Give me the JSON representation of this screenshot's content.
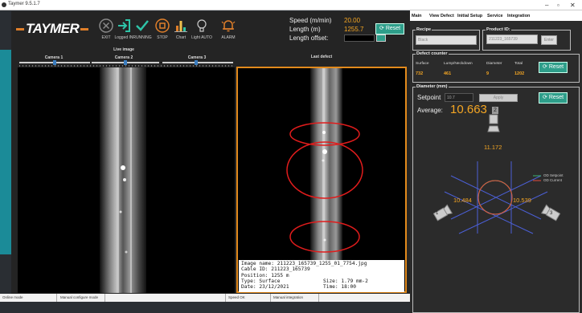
{
  "window": {
    "title": "Taymer 9.5.1.7"
  },
  "brand": {
    "logo_text": "TAYMER"
  },
  "toolbar": {
    "exit": "EXIT",
    "login": "Logged IN",
    "running": "RUNNING",
    "stop": "STOP",
    "chart": "Chart",
    "light": "Light AUTO",
    "alarm": "ALARM"
  },
  "readouts": {
    "speed_label": "Speed (m/min)",
    "speed_value": "20.00",
    "length_label": "Length (m)",
    "length_value": "1255.7",
    "offset_label": "Length offset:",
    "reset": "Reset"
  },
  "live": {
    "title": "Live image",
    "cam1": "Camera 1",
    "cam2": "Camera 2",
    "cam3": "Camera 3"
  },
  "last_defect": {
    "title": "Last defect",
    "image_name": "Image name: 211223_165739_1255_01_7754.jpg",
    "cable_id": "Cable ID: 211223_165739",
    "position": "Position: 1255 m",
    "type": "Type: Surface",
    "size": "Size: 1.79 mm-2",
    "date": "Date: 23/12/2021",
    "time": "Time: 18:00"
  },
  "status": {
    "online": "Online mode",
    "manual_config": "Manual configure mode",
    "speed": "Speed OK",
    "integration": "Manual integration"
  },
  "panel": {
    "tabs": [
      "Main",
      "View Defect",
      "Initial Setup",
      "Service",
      "Integration"
    ],
    "recipe": {
      "title": "Recipe",
      "value": "Black"
    },
    "product": {
      "title": "Product ID:",
      "value": "211223_165739",
      "button": "Enter"
    },
    "defects": {
      "title": "Defect counter",
      "headers": [
        "Surface",
        "Lump/Neckdown",
        "Diameter",
        "Total"
      ],
      "values": [
        "732",
        "461",
        "9",
        "1202"
      ],
      "reset": "Reset"
    },
    "diameter": {
      "title": "Diameter (mm)",
      "setpoint_label": "Setpoint",
      "setpoint_value": "10.7",
      "apply": "Apply",
      "reset": "Reset",
      "average_label": "Average:",
      "average_value": "10.663",
      "cam_top": "2",
      "cam_left": "1",
      "cam_right": "3",
      "d_top": "11.172",
      "d_left": "10.484",
      "d_right": "10.539",
      "legend_setpoint": "OD Setpoint",
      "legend_current": "OD Current"
    }
  },
  "colors": {
    "accent": "#f5a623",
    "teal": "#2e9e8a",
    "defect_frame": "#e28a1c",
    "setpoint_line": "#3cb371",
    "current_line": "#e74c3c"
  }
}
